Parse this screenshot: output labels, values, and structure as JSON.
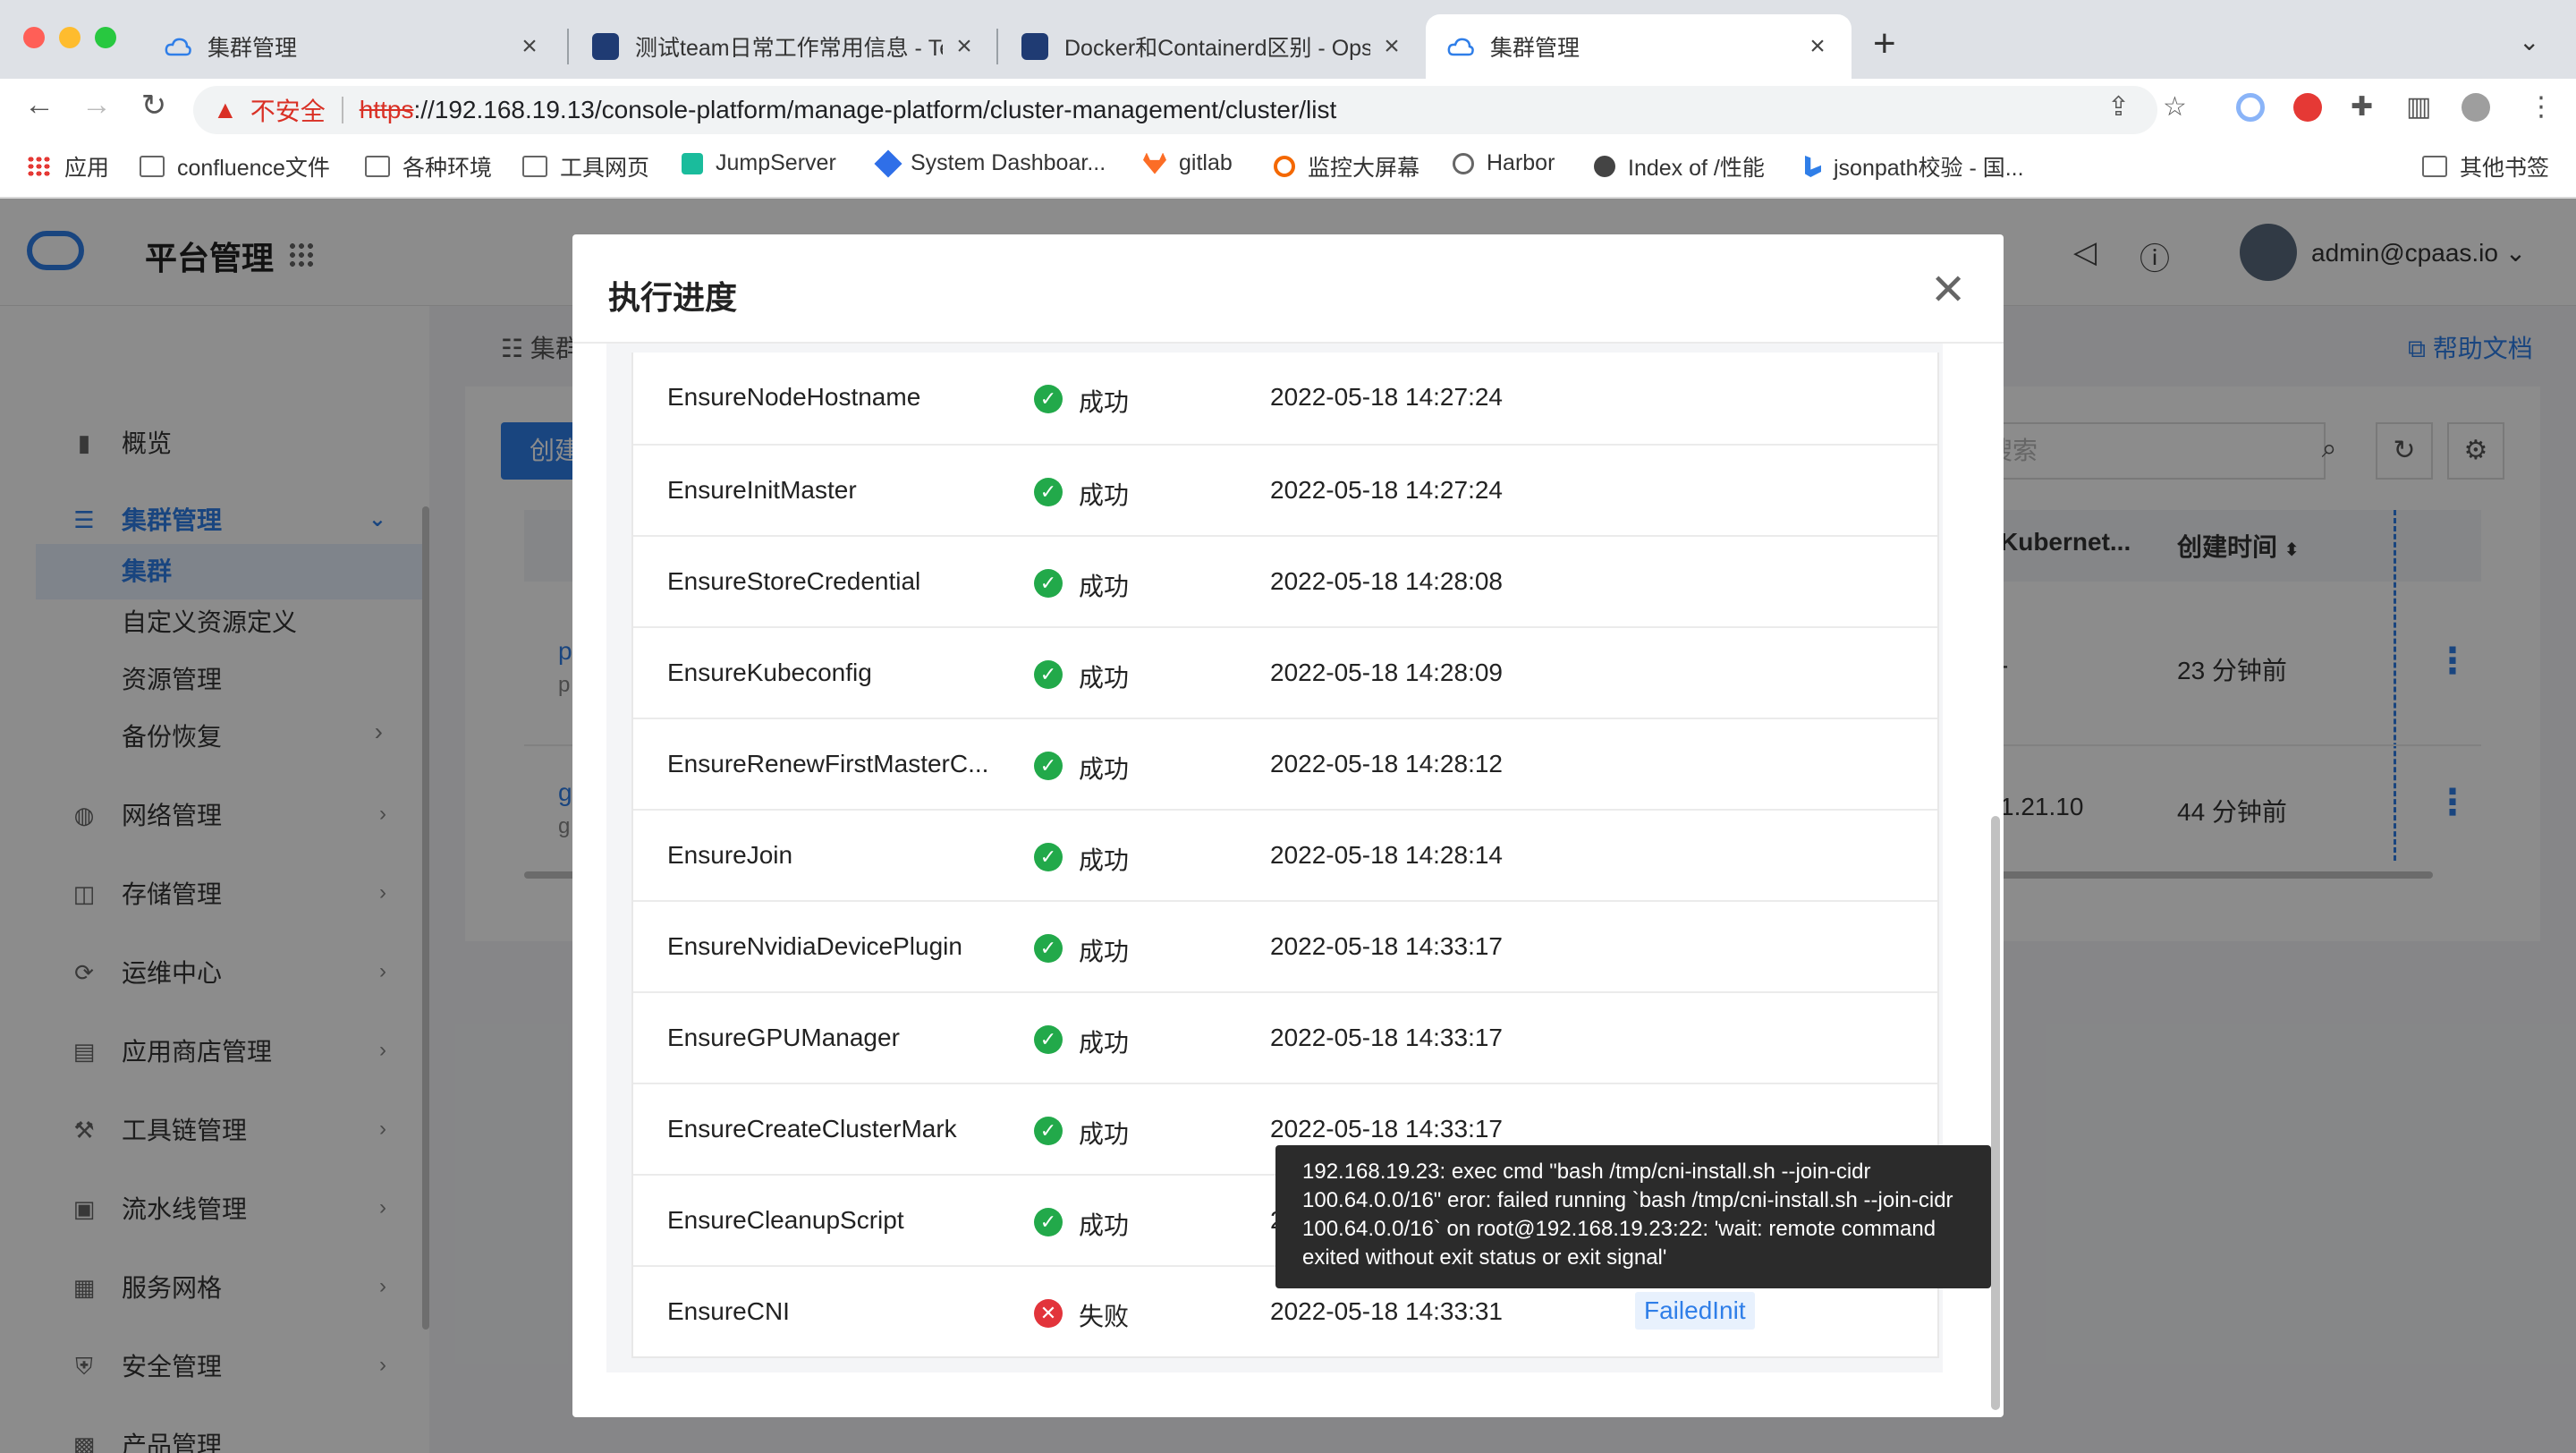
{
  "browser": {
    "tabs": [
      {
        "title": "集群管理",
        "active": false
      },
      {
        "title": "测试team日常工作常用信息 - Te",
        "active": false
      },
      {
        "title": "Docker和Containerd区别 - Ops",
        "active": false
      },
      {
        "title": "集群管理",
        "active": true
      }
    ],
    "url": {
      "insecure_label": "不安全",
      "scheme": "https",
      "rest": "://192.168.19.13/console-platform/manage-platform/cluster-management/cluster/list"
    },
    "bookmarks": [
      "应用",
      "confluence文件",
      "各种环境",
      "工具网页",
      "JumpServer",
      "System Dashboar...",
      "gitlab",
      "监控大屏幕",
      "Harbor",
      "Index of /性能",
      "jsonpath校验 - 国..."
    ],
    "other_bookmarks": "其他书签"
  },
  "app": {
    "platform_title": "平台管理",
    "user": "admin@cpaas.io",
    "help_doc": "帮助文档",
    "breadcrumb": "集群",
    "create_button": "创建",
    "search_placeholder": "搜索",
    "table_headers": {
      "kubernetes": "Kubernet...",
      "created": "创建时间"
    },
    "rows": [
      {
        "name": "p",
        "sub": "p",
        "k8s": "-",
        "created": "23 分钟前"
      },
      {
        "name": "g",
        "sub": "g",
        "k8s": "1.21.10",
        "created": "44 分钟前"
      }
    ],
    "sidebar": {
      "items": [
        {
          "label": "概览",
          "icon": "chart-icon"
        },
        {
          "label": "集群管理",
          "icon": "cluster-icon",
          "active": true
        },
        {
          "label": "网络管理",
          "icon": "globe-icon"
        },
        {
          "label": "存储管理",
          "icon": "database-icon"
        },
        {
          "label": "运维中心",
          "icon": "ops-icon"
        },
        {
          "label": "应用商店管理",
          "icon": "store-icon"
        },
        {
          "label": "工具链管理",
          "icon": "tools-icon"
        },
        {
          "label": "流水线管理",
          "icon": "pipeline-icon"
        },
        {
          "label": "服务网格",
          "icon": "mesh-icon"
        },
        {
          "label": "安全管理",
          "icon": "shield-icon"
        },
        {
          "label": "产品管理",
          "icon": "box-icon"
        }
      ],
      "sub_items": [
        "集群",
        "自定义资源定义",
        "资源管理",
        "备份恢复"
      ]
    }
  },
  "modal": {
    "title": "执行进度",
    "steps": [
      {
        "name": "EnsureNodeHostname",
        "status": "成功",
        "time": "2022-05-18 14:27:24"
      },
      {
        "name": "EnsureInitMaster",
        "status": "成功",
        "time": "2022-05-18 14:27:24"
      },
      {
        "name": "EnsureStoreCredential",
        "status": "成功",
        "time": "2022-05-18 14:28:08"
      },
      {
        "name": "EnsureKubeconfig",
        "status": "成功",
        "time": "2022-05-18 14:28:09"
      },
      {
        "name": "EnsureRenewFirstMasterC...",
        "status": "成功",
        "time": "2022-05-18 14:28:12"
      },
      {
        "name": "EnsureJoin",
        "status": "成功",
        "time": "2022-05-18 14:28:14"
      },
      {
        "name": "EnsureNvidiaDevicePlugin",
        "status": "成功",
        "time": "2022-05-18 14:33:17"
      },
      {
        "name": "EnsureGPUManager",
        "status": "成功",
        "time": "2022-05-18 14:33:17"
      },
      {
        "name": "EnsureCreateClusterMark",
        "status": "成功",
        "time": "2022-05-18 14:33:17"
      },
      {
        "name": "EnsureCleanupScript",
        "status": "成功",
        "time": "2022-"
      },
      {
        "name": "EnsureCNI",
        "status": "失败",
        "time": "2022-05-18 14:33:31",
        "reason": "FailedInit"
      }
    ],
    "tooltip": "192.168.19.23: exec cmd \"bash /tmp/cni-install.sh --join-cidr 100.64.0.0/16\" eror: failed running `bash /tmp/cni-install.sh --join-cidr 100.64.0.0/16` on root@192.168.19.23:22: 'wait: remote command exited without exit status or exit signal'"
  },
  "colors": {
    "accent": "#2f7ee8",
    "success": "#22a94a",
    "danger": "#e2343b"
  }
}
